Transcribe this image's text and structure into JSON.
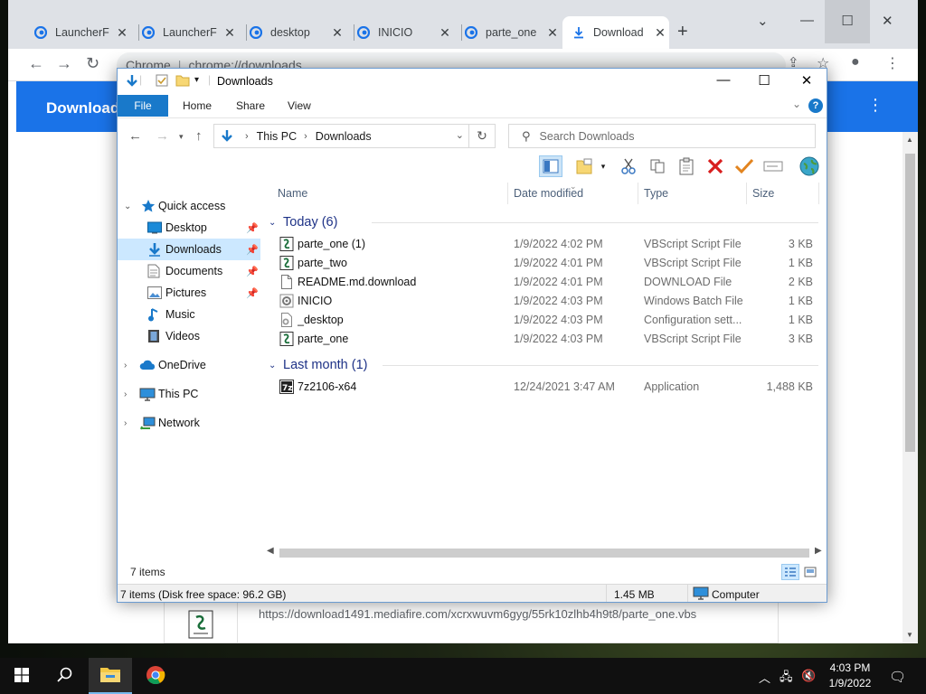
{
  "chrome": {
    "tabs": [
      {
        "title": "LauncherF",
        "active": false
      },
      {
        "title": "LauncherF",
        "active": false
      },
      {
        "title": "desktop",
        "active": false
      },
      {
        "title": "INICIO",
        "active": false
      },
      {
        "title": "parte_one",
        "active": false
      },
      {
        "title": "Download",
        "active": true
      }
    ],
    "new_tab": "+",
    "omnibox": {
      "site": "Chrome",
      "url": "chrome://downloads"
    },
    "page_title": "Downloads",
    "download_url": "https://download1491.mediafire.com/xcrxwuvm6gyg/55rk10zlhb4h9t8/parte_one.vbs",
    "colors": {
      "accent": "#1a73e8",
      "tabstrip": "#dee1e6"
    }
  },
  "explorer": {
    "title": "Downloads",
    "ribbon_tabs": [
      "File",
      "Home",
      "Share",
      "View"
    ],
    "breadcrumb": [
      "This PC",
      "Downloads"
    ],
    "search_placeholder": "Search Downloads",
    "nav": [
      {
        "label": "Quick access",
        "icon": "star-icon",
        "expanded": true
      },
      {
        "label": "Desktop",
        "icon": "desktop-folder-icon",
        "pinned": true
      },
      {
        "label": "Downloads",
        "icon": "downloads-folder-icon",
        "pinned": true,
        "selected": true
      },
      {
        "label": "Documents",
        "icon": "documents-folder-icon",
        "pinned": true
      },
      {
        "label": "Pictures",
        "icon": "pictures-folder-icon",
        "pinned": true
      },
      {
        "label": "Music",
        "icon": "music-folder-icon"
      },
      {
        "label": "Videos",
        "icon": "videos-folder-icon"
      },
      {
        "label": "OneDrive",
        "icon": "onedrive-icon"
      },
      {
        "label": "This PC",
        "icon": "this-pc-icon"
      },
      {
        "label": "Network",
        "icon": "network-icon"
      }
    ],
    "columns": [
      "Name",
      "Date modified",
      "Type",
      "Size"
    ],
    "groups": [
      {
        "label": "Today (6)",
        "files": [
          {
            "name": "parte_one (1)",
            "date": "1/9/2022 4:02 PM",
            "type": "VBScript Script File",
            "size": "3 KB",
            "icon": "vbscript-file-icon"
          },
          {
            "name": "parte_two",
            "date": "1/9/2022 4:01 PM",
            "type": "VBScript Script File",
            "size": "1 KB",
            "icon": "vbscript-file-icon"
          },
          {
            "name": "README.md.download",
            "date": "1/9/2022 4:01 PM",
            "type": "DOWNLOAD File",
            "size": "2 KB",
            "icon": "blank-file-icon"
          },
          {
            "name": "INICIO",
            "date": "1/9/2022 4:03 PM",
            "type": "Windows Batch File",
            "size": "1 KB",
            "icon": "batch-file-icon"
          },
          {
            "name": "_desktop",
            "date": "1/9/2022 4:03 PM",
            "type": "Configuration sett...",
            "size": "1 KB",
            "icon": "config-file-icon"
          },
          {
            "name": "parte_one",
            "date": "1/9/2022 4:03 PM",
            "type": "VBScript Script File",
            "size": "3 KB",
            "icon": "vbscript-file-icon"
          }
        ]
      },
      {
        "label": "Last month (1)",
        "files": [
          {
            "name": "7z2106-x64",
            "date": "12/24/2021 3:47 AM",
            "type": "Application",
            "size": "1,488 KB",
            "icon": "7zip-app-icon"
          }
        ]
      }
    ],
    "item_count": "7 items",
    "status": {
      "left": "7 items (Disk free space: 96.2 GB)",
      "size": "1.45 MB",
      "location": "Computer"
    }
  },
  "taskbar": {
    "clock_time": "4:03 PM",
    "clock_date": "1/9/2022"
  }
}
